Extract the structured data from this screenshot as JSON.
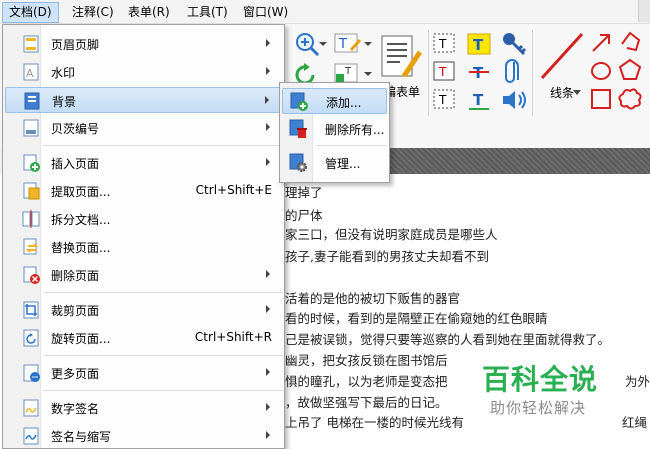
{
  "menubar": {
    "items": [
      "文档(D)",
      "注释(C)",
      "表单(R)",
      "工具(T)",
      "窗口(W)"
    ]
  },
  "toolbar": {
    "form_label": "编表单",
    "line_label": "线条"
  },
  "main_menu": {
    "items": [
      {
        "label": "页眉页脚",
        "submenu": true
      },
      {
        "label": "水印",
        "submenu": true
      },
      {
        "label": "背景",
        "submenu": true
      },
      {
        "label": "贝茨编号",
        "submenu": true
      },
      {
        "label": "插入页面",
        "submenu": true
      },
      {
        "label": "提取页面...",
        "shortcut": "Ctrl+Shift+E"
      },
      {
        "label": "拆分文档..."
      },
      {
        "label": "替换页面..."
      },
      {
        "label": "删除页面",
        "submenu": true
      },
      {
        "label": "裁剪页面",
        "submenu": true
      },
      {
        "label": "旋转页面...",
        "shortcut": "Ctrl+Shift+R"
      },
      {
        "label": "更多页面",
        "submenu": true
      },
      {
        "label": "数字签名",
        "submenu": true
      },
      {
        "label": "签名与缩写",
        "submenu": true
      }
    ]
  },
  "background_submenu": {
    "items": [
      "添加...",
      "删除所有...",
      "管理..."
    ]
  },
  "document": {
    "lines": [
      "理掉了",
      "的尸体",
      "家三口，但没有说明家庭成员是哪些人",
      "孩子,妻子能看到的男孩丈夫却看不到",
      "",
      "活着的是他的被切下贩售的器官",
      "看的时候，看到的是隔壁正在偷窥她的红色眼睛",
      "己是被误锁，觉得只要等巡察的人看到她在里面就得救了。",
      "幽灵，把女孩反锁在图书馆后",
      "惧的瞳孔，以为老师是变态把",
      "，故做坚强写下最后的日记。",
      "上吊了  电梯在一楼的时候光线有"
    ],
    "right_fragments": [
      "为外",
      "红绳"
    ]
  },
  "watermark": {
    "title": "百科全说",
    "subtitle": "助你轻松解决"
  }
}
